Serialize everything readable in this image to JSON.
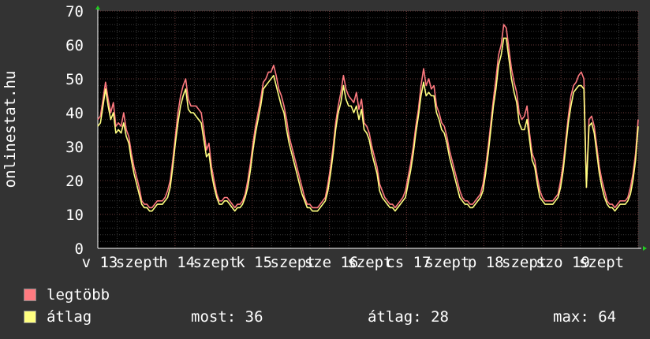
{
  "chart_data": {
    "type": "line",
    "ylabel": "onlinestat.hu",
    "ylim": [
      0,
      70
    ],
    "yticks": [
      0,
      10,
      20,
      30,
      40,
      50,
      60,
      70
    ],
    "xtick_labels": [
      "v 13",
      "szept",
      "h 14",
      "szept",
      "k 15",
      "szept",
      "sze 16",
      "szept",
      "cs 17",
      "szept",
      "p 18",
      "szept",
      "szo 19",
      "szept"
    ],
    "grid": true,
    "series": [
      {
        "name": "legtöbb",
        "color": "#ff7a80",
        "values": [
          38,
          39,
          44,
          49,
          44,
          40,
          43,
          36,
          37,
          36,
          40,
          35,
          33,
          28,
          24,
          21,
          18,
          14,
          13,
          13,
          12,
          12,
          13,
          14,
          14,
          14,
          15,
          17,
          20,
          26,
          33,
          40,
          45,
          48,
          50,
          44,
          42,
          42,
          42,
          41,
          40,
          35,
          29,
          31,
          24,
          20,
          16,
          14,
          14,
          15,
          15,
          14,
          13,
          12,
          13,
          13,
          14,
          16,
          20,
          25,
          31,
          36,
          40,
          44,
          49,
          50,
          52,
          52,
          54,
          51,
          47,
          45,
          42,
          38,
          33,
          30,
          27,
          24,
          21,
          18,
          15,
          13,
          13,
          12,
          12,
          12,
          13,
          14,
          15,
          19,
          24,
          30,
          37,
          42,
          46,
          51,
          47,
          45,
          44,
          43,
          46,
          41,
          44,
          37,
          36,
          34,
          30,
          27,
          24,
          19,
          17,
          15,
          14,
          13,
          13,
          12,
          13,
          14,
          15,
          17,
          21,
          25,
          30,
          36,
          41,
          48,
          53,
          48,
          50,
          47,
          48,
          42,
          40,
          37,
          36,
          33,
          29,
          26,
          23,
          20,
          17,
          15,
          14,
          14,
          13,
          13,
          14,
          15,
          16,
          19,
          24,
          30,
          37,
          44,
          50,
          57,
          60,
          66,
          65,
          59,
          53,
          49,
          46,
          40,
          38,
          39,
          42,
          34,
          28,
          26,
          21,
          17,
          15,
          14,
          14,
          14,
          14,
          15,
          16,
          20,
          25,
          32,
          39,
          45,
          48,
          49,
          51,
          52,
          50,
          18,
          38,
          39,
          36,
          30,
          24,
          20,
          17,
          14,
          13,
          13,
          12,
          13,
          14,
          14,
          14,
          15,
          18,
          22,
          28,
          38
        ]
      },
      {
        "name": "átlag",
        "color": "#ffff80",
        "values": [
          36,
          37,
          42,
          47,
          42,
          38,
          40,
          34,
          35,
          34,
          37,
          33,
          31,
          26,
          22,
          19,
          16,
          13,
          12,
          12,
          11,
          11,
          12,
          13,
          13,
          13,
          14,
          15,
          18,
          24,
          31,
          37,
          42,
          45,
          47,
          41,
          40,
          40,
          39,
          38,
          37,
          32,
          27,
          28,
          22,
          18,
          15,
          13,
          13,
          14,
          14,
          13,
          12,
          11,
          12,
          12,
          13,
          15,
          18,
          23,
          29,
          34,
          38,
          42,
          47,
          48,
          49,
          50,
          51,
          48,
          45,
          42,
          40,
          35,
          31,
          28,
          25,
          22,
          19,
          16,
          14,
          12,
          12,
          11,
          11,
          11,
          12,
          13,
          14,
          17,
          22,
          28,
          35,
          40,
          43,
          48,
          44,
          42,
          42,
          40,
          42,
          38,
          41,
          35,
          34,
          32,
          28,
          25,
          22,
          17,
          15,
          14,
          13,
          12,
          12,
          11,
          12,
          13,
          14,
          15,
          19,
          23,
          28,
          34,
          39,
          45,
          49,
          45,
          46,
          45,
          45,
          40,
          38,
          35,
          34,
          31,
          27,
          24,
          21,
          18,
          15,
          14,
          13,
          13,
          12,
          12,
          13,
          14,
          15,
          17,
          22,
          28,
          35,
          42,
          47,
          54,
          57,
          62,
          62,
          56,
          50,
          46,
          43,
          37,
          35,
          35,
          38,
          32,
          26,
          24,
          19,
          15,
          14,
          13,
          13,
          13,
          13,
          14,
          15,
          18,
          23,
          30,
          37,
          42,
          46,
          47,
          48,
          48,
          47,
          18,
          36,
          37,
          34,
          28,
          22,
          18,
          15,
          13,
          12,
          12,
          11,
          12,
          13,
          13,
          13,
          14,
          16,
          20,
          26,
          36
        ]
      }
    ]
  },
  "legend": {
    "max_label": "legtöbb",
    "avg_label": "átlag"
  },
  "stats": {
    "now": "most: 36",
    "avg": "átlag: 28",
    "max": "max: 64"
  }
}
